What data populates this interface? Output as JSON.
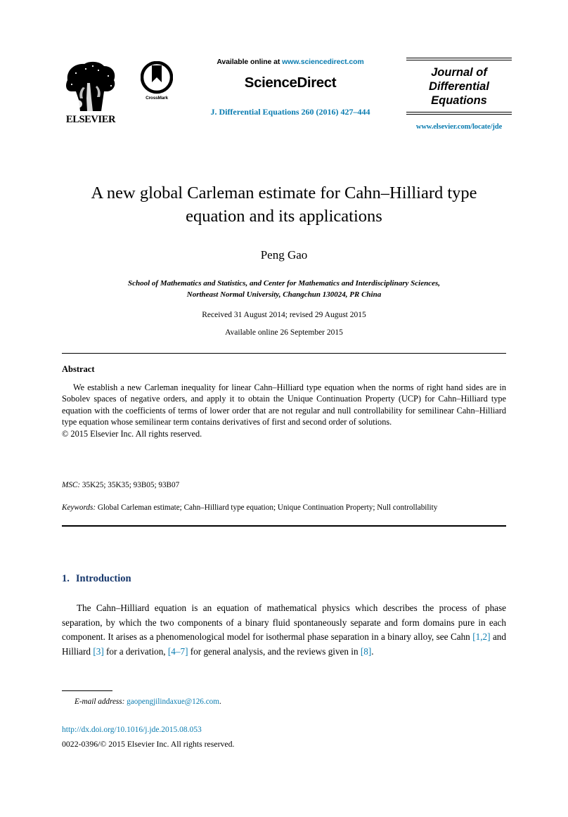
{
  "header": {
    "available_online_prefix": "Available online at ",
    "sciencedirect_url": "www.sciencedirect.com",
    "sciencedirect_wordmark": "ScienceDirect",
    "journal_reference": "J. Differential Equations 260 (2016) 427–444",
    "journal_name_line1": "Journal of",
    "journal_name_line2": "Differential",
    "journal_name_line3": "Equations",
    "journal_url": "www.elsevier.com/locate/jde",
    "publisher_name": "ELSEVIER",
    "crossmark_label": "CrossMark",
    "link_color": "#0a7cb0"
  },
  "title": {
    "line1": "A new global Carleman estimate for Cahn–Hilliard type",
    "line2": "equation and its applications"
  },
  "author": {
    "name": "Peng Gao",
    "affiliation_line1": "School of Mathematics and Statistics, and Center for Mathematics and Interdisciplinary Sciences,",
    "affiliation_line2": "Northeast Normal University, Changchun 130024, PR China",
    "received": "Received 31 August 2014; revised 29 August 2015",
    "available_online": "Available online 26 September 2015"
  },
  "abstract": {
    "heading": "Abstract",
    "body": "We establish a new Carleman inequality for linear Cahn–Hilliard type equation when the norms of right hand sides are in Sobolev spaces of negative orders, and apply it to obtain the Unique Continuation Property (UCP) for Cahn–Hilliard type equation with the coefficients of terms of lower order that are not regular and null controllability for semilinear Cahn–Hilliard type equation whose semilinear term contains derivatives of first and second order of solutions.",
    "copyright": "© 2015 Elsevier Inc. All rights reserved."
  },
  "msc": {
    "label": "MSC:",
    "value": " 35K25; 35K35; 93B05; 93B07"
  },
  "keywords": {
    "label": "Keywords:",
    "value": " Global Carleman estimate; Cahn–Hilliard type equation; Unique Continuation Property; Null controllability"
  },
  "introduction": {
    "number": "1.",
    "heading": "Introduction",
    "text_part1": "The Cahn–Hilliard equation is an equation of mathematical physics which describes the process of phase separation, by which the two components of a binary fluid spontaneously separate and form domains pure in each component. It arises as a phenomenological model for isothermal phase separation in a binary alloy, see Cahn ",
    "cite1": "[1,2]",
    "text_part2": " and Hilliard ",
    "cite2": "[3]",
    "text_part3": " for a derivation, ",
    "cite3": "[4–7]",
    "text_part4": " for general analysis, and the reviews given in ",
    "cite4": "[8]",
    "text_part5": "."
  },
  "footer": {
    "email_label": "E-mail address:",
    "email_address": "gaopengjilindaxue@126.com",
    "email_suffix": ".",
    "doi": "http://dx.doi.org/10.1016/j.jde.2015.08.053",
    "issn_copyright": "0022-0396/© 2015 Elsevier Inc. All rights reserved."
  }
}
